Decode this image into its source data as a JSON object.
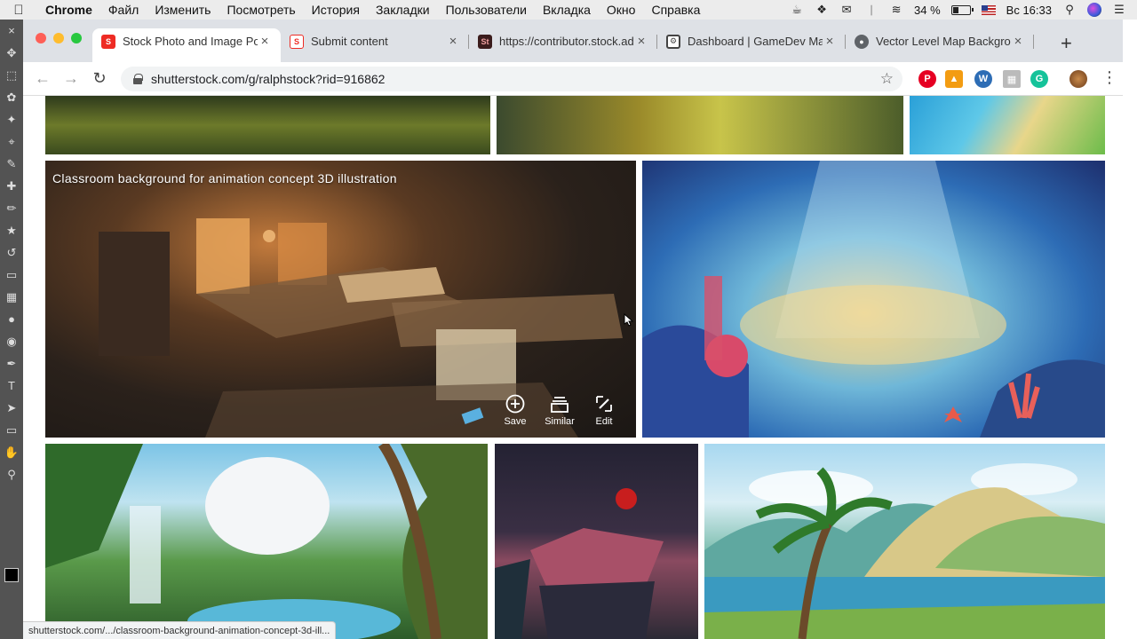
{
  "menubar": {
    "app": "Chrome",
    "items": [
      "Файл",
      "Изменить",
      "Посмотреть",
      "История",
      "Закладки",
      "Пользователи",
      "Вкладка",
      "Окно",
      "Справка"
    ],
    "battery_percent": "34 %",
    "battery_level": 0.34,
    "clock": "Вс 16:33"
  },
  "tabs": [
    {
      "title": "Stock Photo and Image Portfolio",
      "favicon": "shutterstock-icon",
      "favicon_color": "#ee2b24",
      "active": true
    },
    {
      "title": "Submit content",
      "favicon": "shutterstock-icon",
      "favicon_color": "#ee2b24",
      "active": false
    },
    {
      "title": "https://contributor.stock.adobe.com",
      "favicon": "adobe-stock-icon",
      "favicon_color": "#3b1c1c",
      "active": false
    },
    {
      "title": "Dashboard | GameDev Market",
      "favicon": "gamedev-icon",
      "favicon_color": "#444444",
      "active": false
    },
    {
      "title": "Vector Level Map Background",
      "favicon": "globe-icon",
      "favicon_color": "#5f6368",
      "active": false
    }
  ],
  "address": {
    "url": "shutterstock.com/g/ralphstock?rid=916862"
  },
  "gallery": {
    "featured_caption": "Classroom background for animation concept 3D illustration",
    "actions": {
      "save": "Save",
      "similar": "Similar",
      "edit": "Edit"
    }
  },
  "status_url": "shutterstock.com/.../classroom-background-animation-concept-3d-ill...",
  "colors": {
    "tabstrip": "#dee1e6",
    "shutterstock_red": "#ee2b24",
    "photoshop_panel": "#535353"
  }
}
